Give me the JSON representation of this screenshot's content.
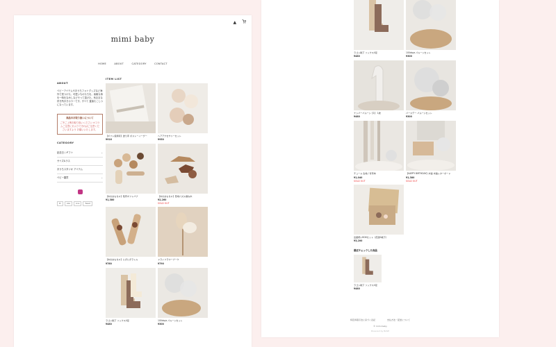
{
  "left_page": {
    "logo": "mimi baby",
    "header_icons": [
      "▲",
      "🛒"
    ],
    "nav": [
      "HOME",
      "ABOUT",
      "CATEGORY",
      "CONTACT"
    ],
    "about": {
      "title": "ABOUT",
      "text": "ベビーアイテムやおうちフォトグッズなど海外で見つけた、可愛いものたちを。素敵な事を一時をなみしなどやって頂けた。気ままな好き所おきカラーです。すべて 直接たこしつになっています。"
    },
    "notice": {
      "title": "商品のお取り扱いについて",
      "body": "ご不ご上等お取り扱いください ※コラムご注意にお入りできればご注意くださいますよう お願いいたします。"
    },
    "category": {
      "title": "CATEGORY",
      "items": [
        "記念日 / ギフト",
        "サイズ&ラス",
        "おうちスタジオ アイテム",
        "ベビー雑貨"
      ]
    },
    "share": [
      "B!",
      "Like",
      "Line",
      "Tweet"
    ],
    "item_list_title": "ITEM LIST",
    "items": [
      {
        "caption": "【ギフト使用可】送り手 ポストーイーグー",
        "price": "¥916",
        "sold": ""
      },
      {
        "caption": "ヘアアクセサリーセット",
        "price": "¥950",
        "sold": ""
      },
      {
        "caption": "【木のおもちゃ】知育ギフトバブ",
        "price": "¥1,380",
        "sold": ""
      },
      {
        "caption": "【木のおもちゃ】恐竜パズル積み木",
        "price": "¥2,260",
        "sold": "SOLD OUT"
      },
      {
        "caption": "【木のおもちゃ】にぎにぎラトル",
        "price": "¥760",
        "sold": ""
      },
      {
        "caption": "ドライフラワーブーケ",
        "price": "¥790",
        "sold": ""
      },
      {
        "caption": "ラゴン靴下 ソックス4足",
        "price": "¥480",
        "sold": ""
      },
      {
        "caption": "100days バルーンセット",
        "price": "¥300",
        "sold": ""
      }
    ]
  },
  "right_page": {
    "items": [
      {
        "caption": "ラゴン靴下 ソックス4足",
        "price": "¥480",
        "sold": ""
      },
      {
        "caption": "100days バルーンセット",
        "price": "¥300",
        "sold": ""
      },
      {
        "caption": "ナンバーバルーン【1】 1歳",
        "price": "¥480",
        "sold": ""
      },
      {
        "caption": "バースデー バルーンセット",
        "price": "¥300",
        "sold": ""
      },
      {
        "caption": "チュール 生地 / 背景布",
        "price": "¥1,040",
        "sold": "SOLD OUT"
      },
      {
        "caption": "【HAPPY BIRTHDAY】木製 木製レターボード",
        "price": "¥1,380",
        "sold": "SOLD OUT"
      },
      {
        "caption": "出産祝いBOXセット（花冠&靴下）",
        "price": "¥3,200",
        "sold": ""
      }
    ],
    "recent_title": "最近チェックした商品",
    "recent_item": {
      "caption": "ラゴン靴下 ソックス4足",
      "price": "¥480"
    },
    "footer_links": [
      "特定商取引法に基づく表記",
      "支払方法・配送について"
    ],
    "footer_copy": "© mimi baby",
    "footer_powered": "Powered by BASE"
  }
}
